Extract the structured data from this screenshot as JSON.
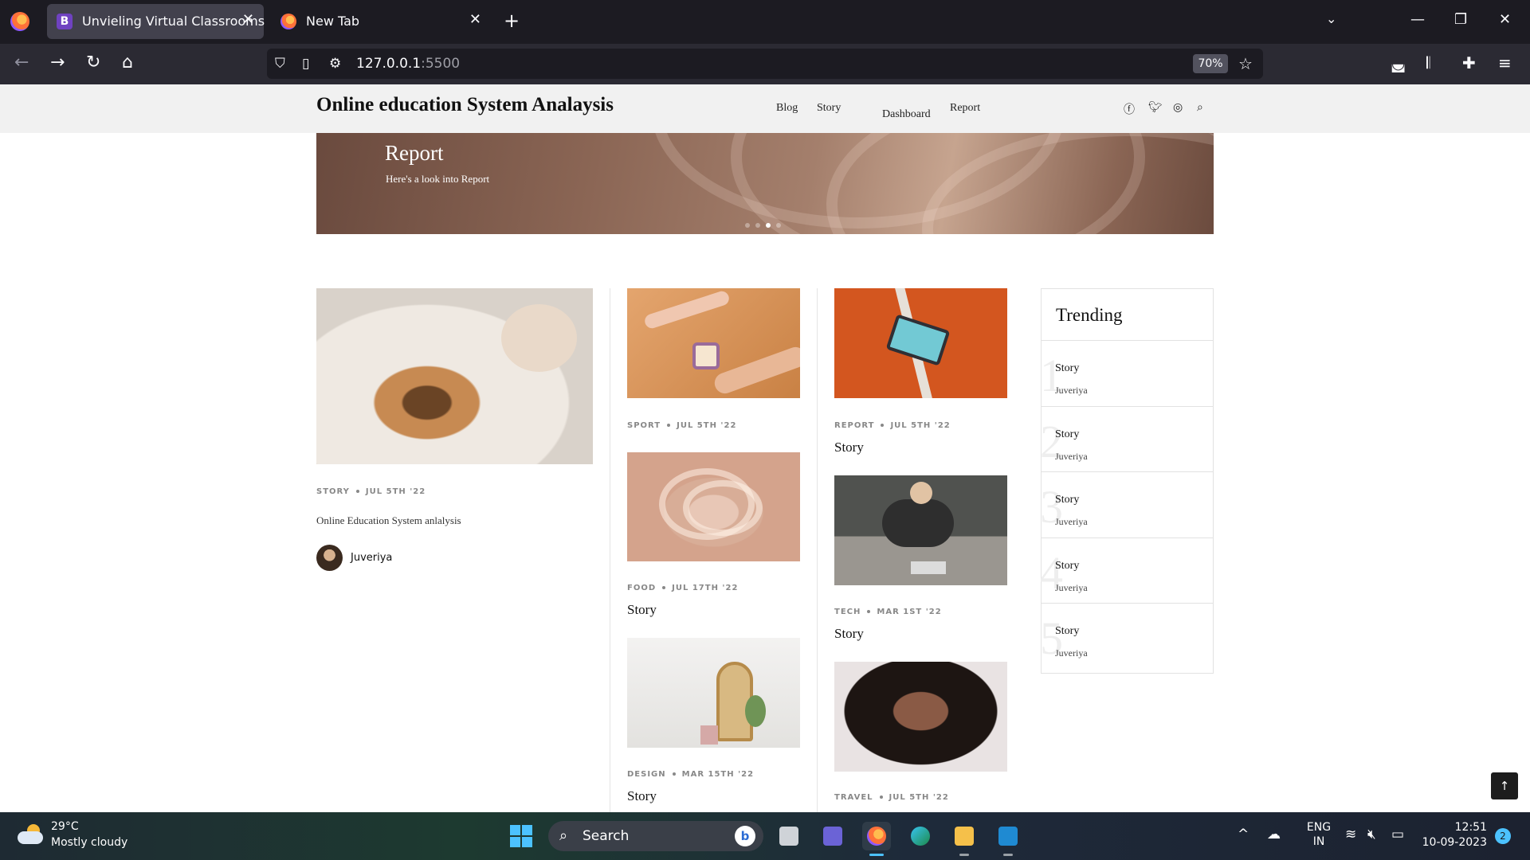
{
  "browser": {
    "tabs": [
      {
        "title": "Unvieling Virtual Classrooms",
        "icon": "B",
        "active": true
      },
      {
        "title": "New Tab",
        "active": false
      }
    ],
    "new_tab_label": "+",
    "url_host": "127.0.0.1",
    "url_port": ":5500",
    "zoom": "70%"
  },
  "site": {
    "title": "Online education System Analaysis",
    "menu": [
      "Blog",
      "Story",
      "Dashboard",
      "Report"
    ],
    "social_icons": [
      "facebook-icon",
      "twitter-icon",
      "instagram-icon",
      "search-icon"
    ]
  },
  "hero": {
    "title": "Report",
    "subtitle": "Here's a look into Report",
    "slide_count": 4,
    "active_slide": 3
  },
  "featured": {
    "category": "STORY",
    "date": "JUL 5TH '22",
    "description": "Online Education System anlalysis",
    "author": "Juveriya"
  },
  "column2": [
    {
      "category": "SPORT",
      "date": "JUL 5TH '22",
      "title": ""
    },
    {
      "category": "FOOD",
      "date": "JUL 17TH '22",
      "title": "Story"
    },
    {
      "category": "DESIGN",
      "date": "MAR 15TH '22",
      "title": "Story"
    }
  ],
  "column3": [
    {
      "category": "REPORT",
      "date": "JUL 5TH '22",
      "title": "Story"
    },
    {
      "category": "TECH",
      "date": "MAR 1ST '22",
      "title": "Story"
    },
    {
      "category": "TRAVEL",
      "date": "JUL 5TH '22",
      "title": ""
    }
  ],
  "trending": {
    "heading": "Trending",
    "items": [
      {
        "num": "1",
        "title": "Story",
        "author": "Juveriya"
      },
      {
        "num": "2",
        "title": "Story",
        "author": "Juveriya"
      },
      {
        "num": "3",
        "title": "Story",
        "author": "Juveriya"
      },
      {
        "num": "4",
        "title": "Story",
        "author": "Juveriya"
      },
      {
        "num": "5",
        "title": "Story",
        "author": "Juveriya"
      }
    ]
  },
  "back_to_top": "↑",
  "taskbar": {
    "temperature": "29°C",
    "condition": "Mostly cloudy",
    "search_label": "Search",
    "language": "ENG",
    "region": "IN",
    "time": "12:51",
    "date": "10-09-2023",
    "notifications": "2"
  }
}
